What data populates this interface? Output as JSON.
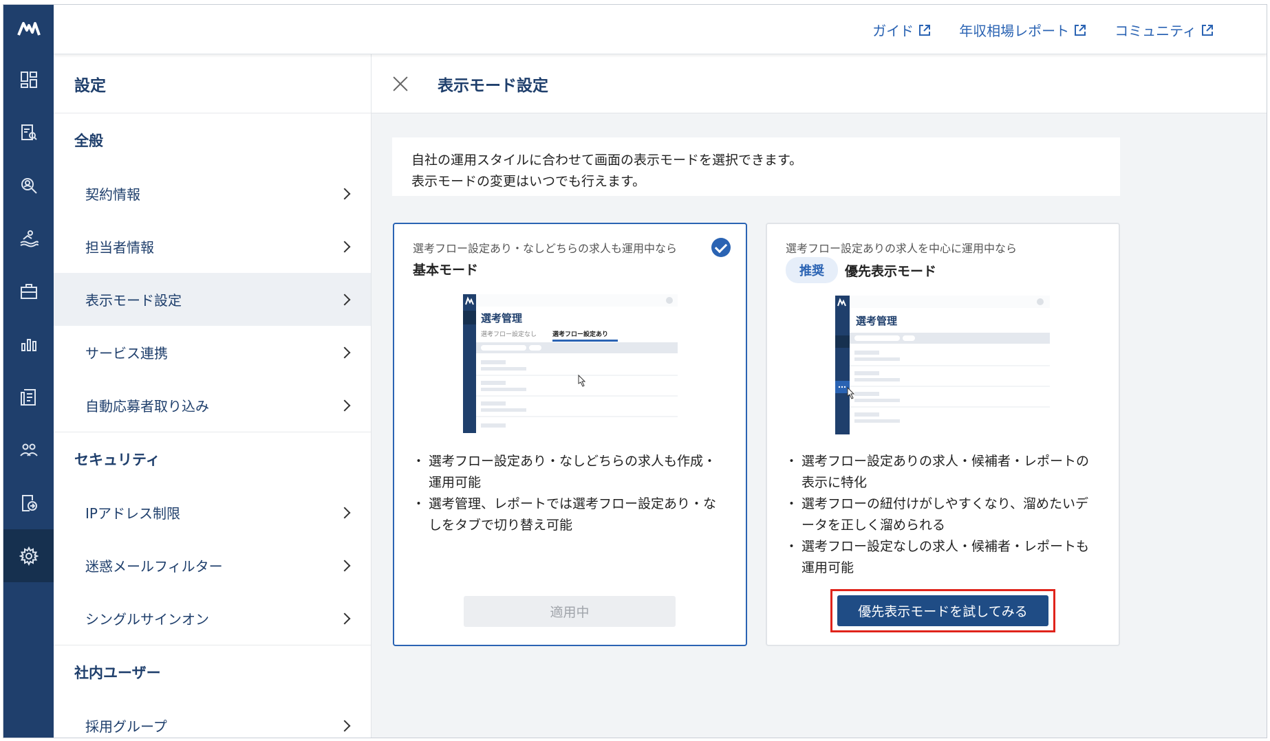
{
  "brand": {
    "accent": "#2a63b3",
    "navy": "#1f3f6c",
    "highlight": "#e0241b"
  },
  "rail": {
    "icons": [
      "dashboard-icon",
      "job-search-icon",
      "candidate-search-icon",
      "recruit-icon",
      "briefcase-icon",
      "report-chart-icon",
      "document-list-icon",
      "users-icon",
      "import-icon",
      "settings-gear-icon"
    ]
  },
  "topbar": {
    "links": [
      {
        "label": "ガイド"
      },
      {
        "label": "年収相場レポート"
      },
      {
        "label": "コミュニティ"
      }
    ]
  },
  "sidenav": {
    "title": "設定",
    "groups": [
      {
        "label": "全般",
        "items": [
          "契約情報",
          "担当者情報",
          "表示モード設定",
          "サービス連携",
          "自動応募者取り込み"
        ]
      },
      {
        "label": "セキュリティ",
        "items": [
          "IPアドレス制限",
          "迷惑メールフィルター",
          "シングルサインオン"
        ]
      },
      {
        "label": "社内ユーザー",
        "items": [
          "採用グループ"
        ]
      }
    ],
    "active_item": "表示モード設定"
  },
  "main": {
    "title": "表示モード設定",
    "description": [
      "自社の運用スタイルに合わせて画面の表示モードを選択できます。",
      "表示モードの変更はいつでも行えます。"
    ],
    "cards": [
      {
        "subtitle": "選考フロー設定あり・なしどちらの求人も運用中なら",
        "mode": "基本モード",
        "preview": {
          "title": "選考管理",
          "tab_off": "選考フロー設定なし",
          "tab_on": "選考フロー設定あり"
        },
        "bullets": [
          "選考フロー設定あり・なしどちらの求人も作成・運用可能",
          "選考管理、レポートでは選考フロー設定あり・なしをタブで切り替え可能"
        ],
        "button": "適用中"
      },
      {
        "subtitle": "選考フロー設定ありの求人を中心に運用中なら",
        "badge": "推奨",
        "mode": "優先表示モード",
        "preview": {
          "title": "選考管理"
        },
        "bullets": [
          "選考フロー設定ありの求人・候補者・レポートの表示に特化",
          "選考フローの紐付けがしやすくなり、溜めたいデータを正しく溜められる",
          "選考フロー設定なしの求人・候補者・レポートも運用可能"
        ],
        "button": "優先表示モードを試してみる"
      }
    ]
  }
}
